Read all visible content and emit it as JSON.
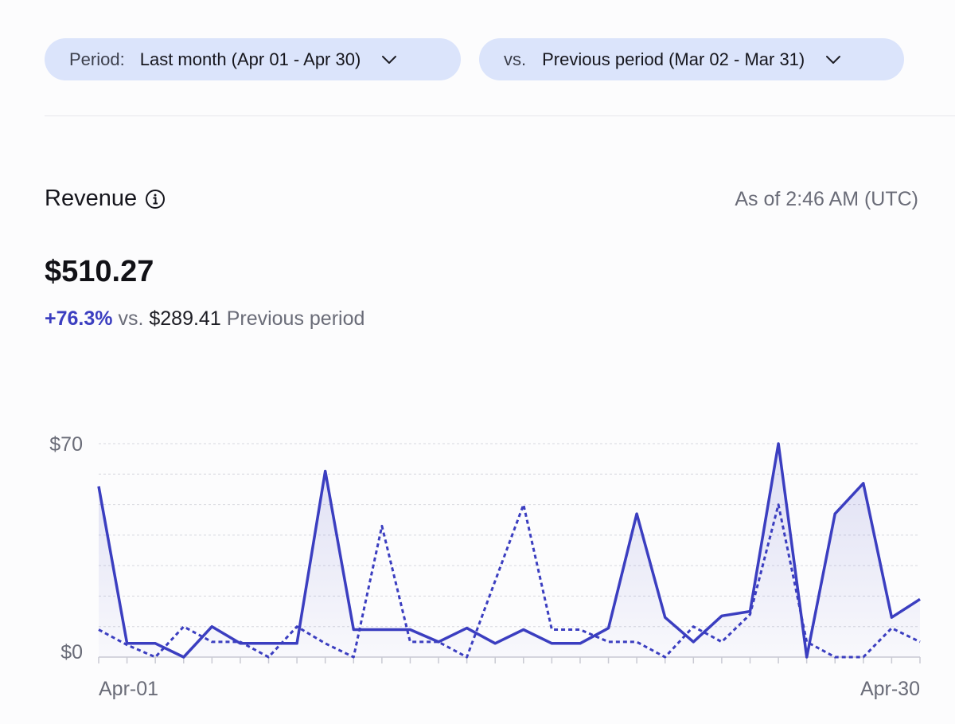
{
  "filters": {
    "period": {
      "label": "Period:",
      "value": "Last month (Apr 01 - Apr 30)"
    },
    "compare": {
      "label": "vs.",
      "value": "Previous period (Mar 02 - Mar 31)"
    }
  },
  "revenue": {
    "title": "Revenue",
    "as_of": "As of 2:46 AM (UTC)",
    "total": "$510.27",
    "change_pct": "+76.3%",
    "vs_word": "vs.",
    "previous_total": "$289.41",
    "previous_label": "Previous period"
  },
  "colors": {
    "accent": "#3b3ec0",
    "pill_bg": "#dbe4fb"
  },
  "chart_data": {
    "type": "line",
    "x": [
      "Apr-01",
      "Apr-02",
      "Apr-03",
      "Apr-04",
      "Apr-05",
      "Apr-06",
      "Apr-07",
      "Apr-08",
      "Apr-09",
      "Apr-10",
      "Apr-11",
      "Apr-12",
      "Apr-13",
      "Apr-14",
      "Apr-15",
      "Apr-16",
      "Apr-17",
      "Apr-18",
      "Apr-19",
      "Apr-20",
      "Apr-21",
      "Apr-22",
      "Apr-23",
      "Apr-24",
      "Apr-25",
      "Apr-26",
      "Apr-27",
      "Apr-28",
      "Apr-29",
      "Apr-30"
    ],
    "x_tick_labels": [
      "Apr-01",
      "Apr-30"
    ],
    "y_tick_labels": [
      "$70",
      "$0"
    ],
    "ylim": [
      0,
      70
    ],
    "grid": true,
    "series": [
      {
        "style": "solid",
        "values": [
          56,
          4.5,
          4.5,
          0,
          10,
          4.5,
          4.5,
          4.5,
          61,
          9,
          9,
          9,
          5,
          9.5,
          4.5,
          9,
          4.5,
          4.5,
          9.5,
          47,
          13,
          5,
          13.5,
          15,
          70,
          0,
          47,
          57,
          13,
          19
        ]
      },
      {
        "style": "dashed",
        "values": [
          9,
          4,
          0,
          10,
          5,
          5,
          0,
          10,
          4.5,
          0,
          43,
          5,
          5,
          0,
          25,
          50,
          9,
          9,
          5,
          5,
          0,
          10,
          5,
          14,
          50,
          5,
          0,
          0,
          9.5,
          5
        ]
      }
    ]
  }
}
